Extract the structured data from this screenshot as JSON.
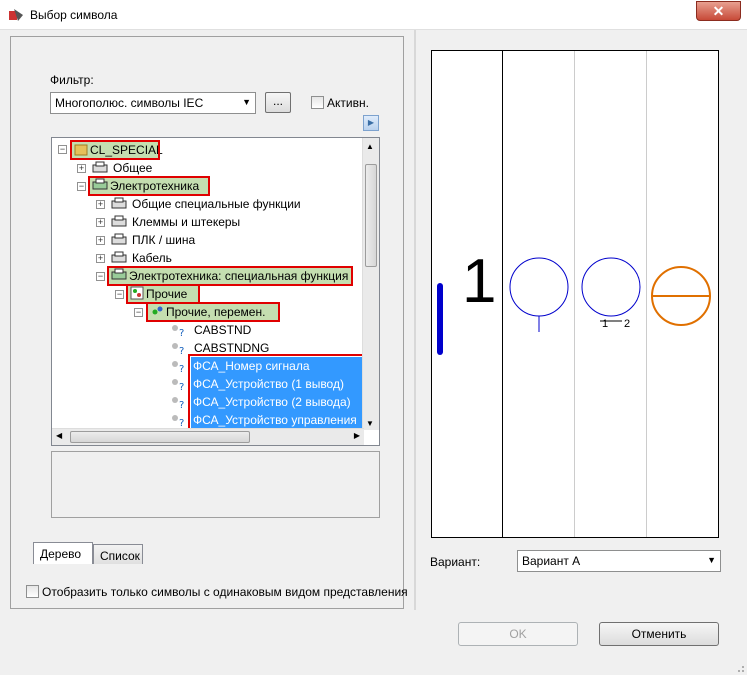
{
  "window": {
    "title": "Выбор символа",
    "close_label": "✕"
  },
  "filter": {
    "label": "Фильтр:",
    "selected": "Многополюс. символы IEC",
    "ellipsis_label": "...",
    "active_label": "Активн."
  },
  "tree": {
    "items": [
      {
        "label": "CL_SPECIAL"
      },
      {
        "label": "Общее"
      },
      {
        "label": "Электротехника"
      },
      {
        "label": "Общие специальные функции"
      },
      {
        "label": "Клеммы и штекеры"
      },
      {
        "label": "ПЛК / шина"
      },
      {
        "label": "Кабель"
      },
      {
        "label": "Электротехника: специальная функция"
      },
      {
        "label": "Прочие"
      },
      {
        "label": "Прочие, перемен."
      },
      {
        "label": "CABSTND"
      },
      {
        "label": "CABSTNDNG"
      },
      {
        "label": "ФСА_Номер сигнала"
      },
      {
        "label": "ФСА_Устройство (1 вывод)"
      },
      {
        "label": "ФСА_Устройство (2 вывода)"
      },
      {
        "label": "ФСА_Устройство управления"
      }
    ]
  },
  "tabs": {
    "tree": "Дерево",
    "list": "Список"
  },
  "same_view_checkbox_label": "Отобразить только символы с одинаковым видом представления",
  "preview": {
    "number": "1",
    "pin1": "1",
    "pin2": "2"
  },
  "variant": {
    "label": "Вариант:",
    "selected": "Вариант A"
  },
  "buttons": {
    "ok": "OK",
    "cancel": "Отменить"
  },
  "colors": {
    "selection": "#3399ff",
    "highlight": "#e00000",
    "symbol_blue": "#0000cc",
    "symbol_orange": "#e07000"
  }
}
